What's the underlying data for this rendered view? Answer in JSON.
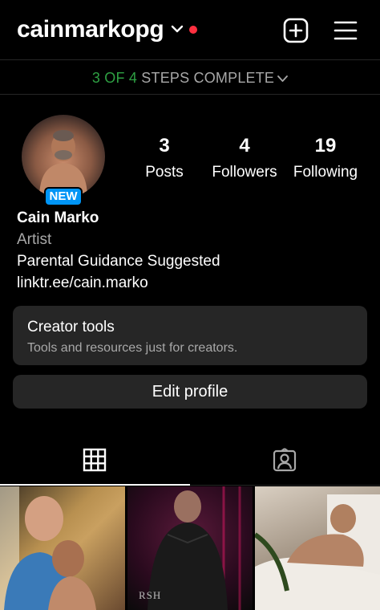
{
  "header": {
    "username": "cainmarkopg",
    "notification_dot_color": "#ff3040",
    "icons": [
      "chevron-down-icon",
      "plus-square-icon",
      "hamburger-menu-icon"
    ]
  },
  "steps_banner": {
    "completed": "3",
    "of_word": "OF",
    "total": "4",
    "suffix": "STEPS COMPLETE",
    "accent": "#2ea043"
  },
  "profile": {
    "new_badge": "NEW",
    "stats": {
      "posts": {
        "value": "3",
        "label": "Posts"
      },
      "followers": {
        "value": "4",
        "label": "Followers"
      },
      "following": {
        "value": "19",
        "label": "Following"
      }
    },
    "name": "Cain Marko",
    "category": "Artist",
    "bio": "Parental Guidance Suggested",
    "link": "linktr.ee/cain.marko"
  },
  "creator_tools": {
    "title": "Creator tools",
    "subtitle": "Tools and resources just for creators."
  },
  "edit_profile_label": "Edit profile",
  "tabs": [
    "grid-icon",
    "tagged-icon"
  ],
  "posts_grid": {
    "watermark": "RSH"
  },
  "colors": {
    "background": "#000000",
    "surface": "#262626",
    "secondary_text": "#a8a8a8",
    "badge": "#0095f6"
  }
}
